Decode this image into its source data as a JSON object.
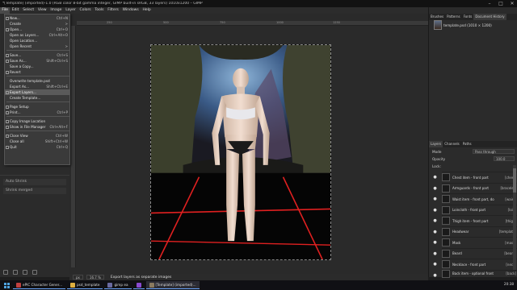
{
  "window": {
    "title": "*[Template] (imported)-1.0 (RGB color 8-bit gamma integer, GIMP built-in sRGB, 33 layers) 1010x1200 – GIMP",
    "min": "–",
    "max": "□",
    "close": "✕"
  },
  "menubar": [
    "File",
    "Edit",
    "Select",
    "View",
    "Image",
    "Layer",
    "Colors",
    "Tools",
    "Filters",
    "Windows",
    "Help"
  ],
  "file_menu": {
    "items": [
      {
        "label": "New...",
        "shortcut": "Ctrl+N"
      },
      {
        "label": "Create",
        "shortcut": ">"
      },
      {
        "label": "Open...",
        "shortcut": "Ctrl+O"
      },
      {
        "label": "Open as Layers...",
        "shortcut": "Ctrl+Alt+O"
      },
      {
        "label": "Open Location...",
        "shortcut": ""
      },
      {
        "label": "Open Recent",
        "shortcut": ">"
      },
      {
        "label": "Save...",
        "shortcut": "Ctrl+S"
      },
      {
        "label": "Save As...",
        "shortcut": "Shift+Ctrl+S"
      },
      {
        "label": "Save a Copy...",
        "shortcut": ""
      },
      {
        "label": "Revert",
        "shortcut": ""
      },
      {
        "label": "Overwrite template.psd",
        "shortcut": ""
      },
      {
        "label": "Export As...",
        "shortcut": "Shift+Ctrl+E"
      },
      {
        "label": "Export Layers...",
        "shortcut": ""
      },
      {
        "label": "Create Template...",
        "shortcut": ""
      },
      {
        "label": "Page Setup",
        "shortcut": ""
      },
      {
        "label": "Print...",
        "shortcut": "Ctrl+P"
      },
      {
        "label": "Copy Image Location",
        "shortcut": ""
      },
      {
        "label": "Show in File Manager",
        "shortcut": "Ctrl+Alt+F"
      },
      {
        "label": "Close View",
        "shortcut": "Ctrl+W"
      },
      {
        "label": "Close all",
        "shortcut": "Shift+Ctrl+W"
      },
      {
        "label": "Quit",
        "shortcut": "Ctrl+Q"
      }
    ],
    "highlighted": "Export Layers..."
  },
  "tool_options": {
    "mode_label": "Mode",
    "auto_shrink": "Auto Shrink",
    "shrink_merged": "Shrink merged"
  },
  "rulers": {
    "top": [
      "250",
      "500",
      "750",
      "1000",
      "1250"
    ],
    "left": [
      "250",
      "500",
      "750",
      "1000"
    ]
  },
  "statusbar": {
    "units": "px",
    "zoom": "16.7 %",
    "message": "Export layers as separate images"
  },
  "right_dock": {
    "top_tabs": [
      "Brushes",
      "Patterns",
      "Fonts",
      "Document History"
    ],
    "image_name": "template.psd (1010 × 1200)",
    "layer_tabs": [
      "Layers",
      "Channels",
      "Paths"
    ],
    "mode_label": "Mode",
    "mode_value": "Pass through",
    "opacity_label": "Opacity",
    "opacity_value": "100.0",
    "lock_label": "Lock:",
    "layers": [
      {
        "name": "Chest item - front part",
        "tag": "[chest]"
      },
      {
        "name": "Armguards - front part",
        "tag": "[bracelet]"
      },
      {
        "name": "Waist item - front part, doesn't hide",
        "tag": "[waist]"
      },
      {
        "name": "Loincloth - front part",
        "tag": "[loin]"
      },
      {
        "name": "Thigh item - front part",
        "tag": "[thigh]"
      },
      {
        "name": "Headwear",
        "tag": "[template]"
      },
      {
        "name": "Mask",
        "tag": "[mask]"
      },
      {
        "name": "Beard",
        "tag": "[beard]"
      },
      {
        "name": "Necklace - front part",
        "tag": "[neck]"
      },
      {
        "name": "Back item - optional front part",
        "tag": "[back]"
      }
    ]
  },
  "taskbar": {
    "apps": [
      {
        "label": "ePIC Character Gener...",
        "color": "#c04040"
      },
      {
        "label": "psd_template",
        "color": "#e0b040"
      },
      {
        "label": "gimp ea",
        "color": "#6a6aa0"
      },
      {
        "label": "",
        "color": "#8a4ad0"
      },
      {
        "label": "[Template] (imported)...",
        "color": "#8a7a60"
      }
    ],
    "time": "20:38"
  }
}
